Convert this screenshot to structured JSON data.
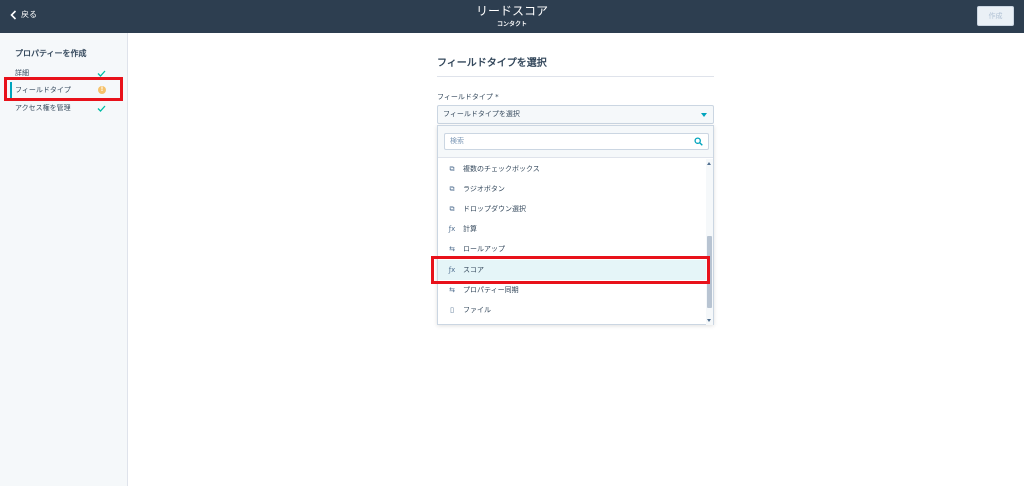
{
  "header": {
    "back_label": "戻る",
    "title": "リードスコア",
    "subtitle": "コンタクト",
    "create_label": "作成"
  },
  "sidebar": {
    "heading": "プロパティーを作成",
    "steps": [
      {
        "label": "詳細",
        "status": "complete"
      },
      {
        "label": "フィールドタイプ",
        "status": "warning"
      },
      {
        "label": "アクセス権を管理",
        "status": "complete"
      }
    ]
  },
  "main": {
    "section_title": "フィールドタイプを選択",
    "field_label": "フィールドタイプ *",
    "select_value": "フィールドタイプを選択",
    "search_placeholder": "検索",
    "options": [
      {
        "label": "複数のチェックボックス",
        "icon": "checkbox-icon"
      },
      {
        "label": "ラジオボタン",
        "icon": "checkbox-icon"
      },
      {
        "label": "ドロップダウン選択",
        "icon": "checkbox-icon"
      },
      {
        "label": "計算",
        "icon": "function-icon"
      },
      {
        "label": "ロールアップ",
        "icon": "rollup-icon"
      },
      {
        "label": "スコア",
        "icon": "function-icon"
      },
      {
        "label": "プロパティー同期",
        "icon": "rollup-icon"
      },
      {
        "label": "ファイル",
        "icon": "file-icon"
      }
    ],
    "selected_option": "スコア"
  },
  "colors": {
    "header_bg": "#2d3e50",
    "accent": "#00a4bd",
    "highlight": "#e8111a",
    "check": "#00bda5",
    "warning": "#f5c26b"
  }
}
